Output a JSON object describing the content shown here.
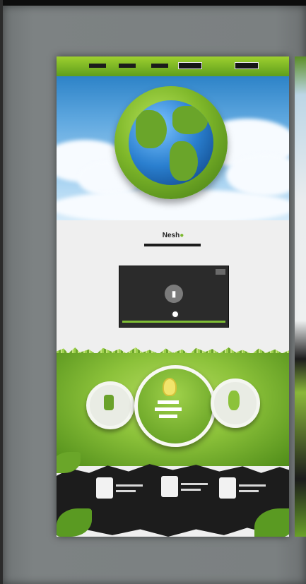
{
  "colors": {
    "brand_green": "#7cb82f",
    "dark": "#1c1c1c",
    "frame_gray": "#7b8081",
    "sky_blue": "#5ea7df"
  },
  "nav": {
    "items": [
      "",
      "",
      "",
      "",
      ""
    ]
  },
  "hero": {
    "icon": "globe-icon"
  },
  "logo": {
    "part1": "Nesh",
    "part2": "●"
  },
  "video": {
    "play_glyph": "▮",
    "icons": [
      "play-icon",
      "close-icon",
      "progress-marker"
    ]
  },
  "features": {
    "icons": [
      "person-icon",
      "lightbulb-icon",
      "tree-icon"
    ]
  },
  "services": {
    "icons": [
      "document-icon",
      "document-icon",
      "document-icon"
    ]
  }
}
